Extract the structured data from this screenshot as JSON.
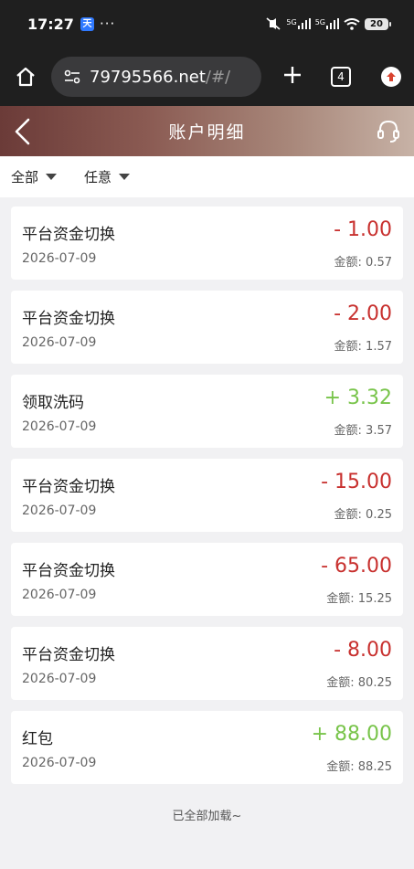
{
  "status_bar": {
    "time": "17:27",
    "app_badge": "天",
    "dots": "···",
    "battery": "20",
    "signal1": "5G",
    "signal2": "5G"
  },
  "browser": {
    "url_host": "79795566.net",
    "url_path": "/#/",
    "tab_count": "4"
  },
  "header": {
    "title": "账户明细"
  },
  "filters": [
    {
      "label": "全部"
    },
    {
      "label": "任意"
    }
  ],
  "transactions": [
    {
      "title": "平台资金切换",
      "date": "2026-07-09",
      "amount": "- 1.00",
      "balance": "金额: 0.57",
      "type": "neg"
    },
    {
      "title": "平台资金切换",
      "date": "2026-07-09",
      "amount": "- 2.00",
      "balance": "金额: 1.57",
      "type": "neg"
    },
    {
      "title": "领取洗码",
      "date": "2026-07-09",
      "amount": "+ 3.32",
      "balance": "金额: 3.57",
      "type": "pos"
    },
    {
      "title": "平台资金切换",
      "date": "2026-07-09",
      "amount": "- 15.00",
      "balance": "金额: 0.25",
      "type": "neg"
    },
    {
      "title": "平台资金切换",
      "date": "2026-07-09",
      "amount": "- 65.00",
      "balance": "金额: 15.25",
      "type": "neg"
    },
    {
      "title": "平台资金切换",
      "date": "2026-07-09",
      "amount": "- 8.00",
      "balance": "金额: 80.25",
      "type": "neg"
    },
    {
      "title": "红包",
      "date": "2026-07-09",
      "amount": "+ 88.00",
      "balance": "金额: 88.25",
      "type": "pos"
    }
  ],
  "footer": {
    "end_text": "已全部加载~"
  },
  "colors": {
    "negative": "#c8312f",
    "positive": "#78c44a",
    "header_start": "#6b3b38",
    "header_end": "#c7b2a6"
  },
  "icons": {
    "home": "home-icon",
    "tune": "tune-icon",
    "back": "chevron-left-icon",
    "support": "headset-icon",
    "update": "update-arrow-icon"
  }
}
